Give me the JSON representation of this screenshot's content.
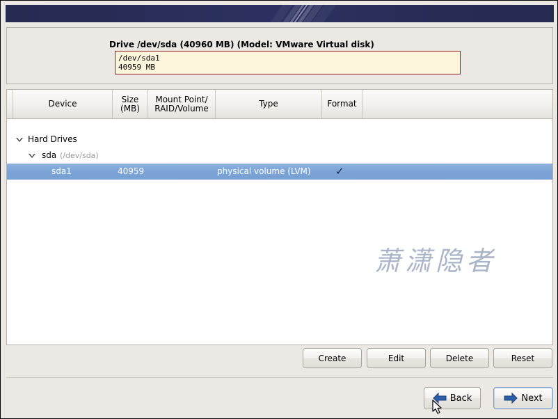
{
  "window": {
    "banner_color": "#2a2f5c"
  },
  "drive": {
    "title": "Drive /dev/sda (40960 MB) (Model: VMware Virtual disk)",
    "partition": {
      "name": "/dev/sda1",
      "size_label": "40959 MB",
      "fill_color": "#fdf6dd",
      "border_color": "#8f1d1d"
    }
  },
  "table": {
    "columns": [
      {
        "label": "Device"
      },
      {
        "label_line1": "Size",
        "label_line2": "(MB)"
      },
      {
        "label_line1": "Mount Point/",
        "label_line2": "RAID/Volume"
      },
      {
        "label": "Type"
      },
      {
        "label": "Format"
      }
    ],
    "rows": [
      {
        "device": "Hard Drives",
        "device_note": "",
        "size": "",
        "mount": "",
        "type": "",
        "format": "",
        "selected": false,
        "depth": 0,
        "expanded": true
      },
      {
        "device": "sda",
        "device_note": "(/dev/sda)",
        "size": "",
        "mount": "",
        "type": "",
        "format": "",
        "selected": false,
        "depth": 1,
        "expanded": true
      },
      {
        "device": "sda1",
        "device_note": "",
        "size": "40959",
        "mount": "",
        "type": "physical volume (LVM)",
        "format": "✓",
        "selected": true,
        "depth": 2,
        "expanded": false
      }
    ],
    "selection_color": "#7ba3d6"
  },
  "watermark": {
    "text": "萧潇隐者"
  },
  "actions": {
    "create_label": "Create",
    "edit_label": "Edit",
    "delete_label": "Delete",
    "reset_label": "Reset"
  },
  "navigation": {
    "back_label": "Back",
    "next_label": "Next",
    "arrow_color": "#2b5fa8"
  }
}
